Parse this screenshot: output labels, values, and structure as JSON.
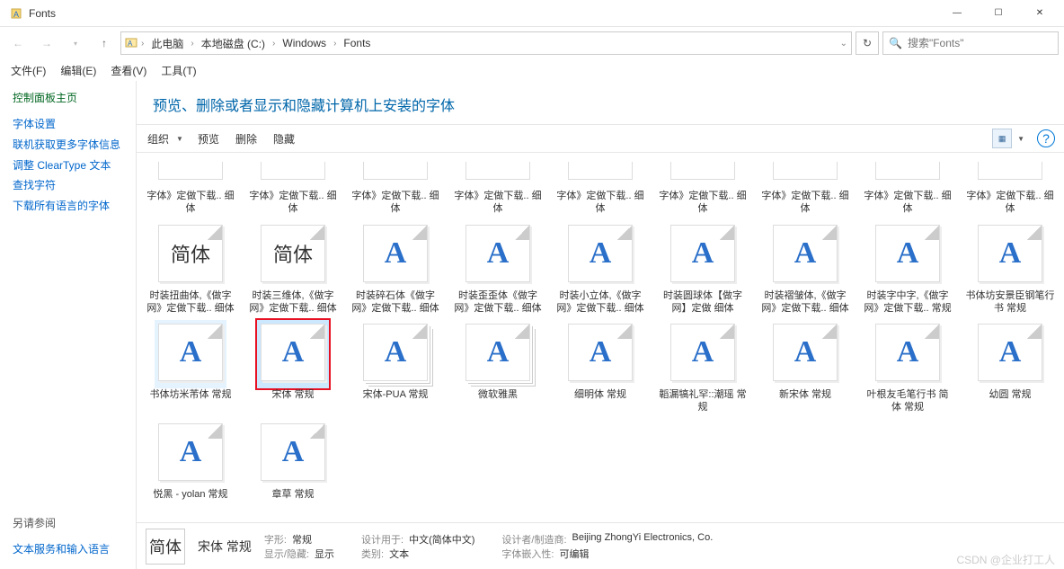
{
  "window": {
    "title": "Fonts"
  },
  "controls": {
    "min": "—",
    "max": "☐",
    "close": "✕"
  },
  "breadcrumbs": [
    "此电脑",
    "本地磁盘 (C:)",
    "Windows",
    "Fonts"
  ],
  "search": {
    "placeholder": "搜索\"Fonts\""
  },
  "menus": [
    "文件(F)",
    "编辑(E)",
    "查看(V)",
    "工具(T)"
  ],
  "sidebar": {
    "head": "控制面板主页",
    "links": [
      "字体设置",
      "联机获取更多字体信息",
      "调整 ClearType 文本",
      "查找字符",
      "下载所有语言的字体"
    ],
    "see_also": "另请参阅",
    "see_links": [
      "文本服务和输入语言"
    ]
  },
  "page_title": "预览、删除或者显示和隐藏计算机上安装的字体",
  "toolbar": {
    "organize": "组织",
    "preview": "预览",
    "delete": "删除",
    "hide": "隐藏"
  },
  "row_cut": [
    "字体》定做下载.. 细体",
    "字体》定做下载.. 细体",
    "字体》定做下载.. 细体",
    "字体》定做下载.. 细体",
    "字体》定做下载.. 细体",
    "字体》定做下载.. 细体",
    "字体》定做下载.. 细体",
    "字体》定做下载.. 细体",
    "字体》定做下载.. 细体"
  ],
  "row1": [
    {
      "label": "时装扭曲体,《做字网》定做下载.. 细体",
      "glyph": "简体",
      "dark": true
    },
    {
      "label": "时装三维体,《做字网》定做下载.. 细体",
      "glyph": "简体",
      "dark": true
    },
    {
      "label": "时装碎石体《做字网》定做下载.. 细体",
      "glyph": "A"
    },
    {
      "label": "时装歪歪体《做字网》定做下载.. 细体",
      "glyph": "A"
    },
    {
      "label": "时装小立体,《做字网》定做下载.. 细体",
      "glyph": "A"
    },
    {
      "label": "时装圆球体【做字网】定做 细体",
      "glyph": "A"
    },
    {
      "label": "时装褶皱体,《做字网》定做下载.. 细体",
      "glyph": "A"
    },
    {
      "label": "时装字中字,《做字网》定做下载.. 常规",
      "glyph": "A"
    },
    {
      "label": "书体坊安景臣钢笔行书 常规",
      "glyph": "A"
    }
  ],
  "row2": [
    {
      "label": "书体坊米芾体 常规",
      "glyph": "A",
      "hover": true
    },
    {
      "label": "宋体 常规",
      "glyph": "A",
      "selected": true
    },
    {
      "label": "宋体-PUA 常规",
      "glyph": "A",
      "stack": true
    },
    {
      "label": "微软雅黑",
      "glyph": "A",
      "stack": true
    },
    {
      "label": "细明体 常规",
      "glyph": "A"
    },
    {
      "label": "韜漏犒礼罕::潮瑶 常规",
      "glyph": "A"
    },
    {
      "label": "新宋体 常规",
      "glyph": "A"
    },
    {
      "label": "叶根友毛笔行书 简体 常规",
      "glyph": "A"
    },
    {
      "label": "幼圆 常规",
      "glyph": "A"
    }
  ],
  "row3": [
    {
      "label": "悦黑 - yolan 常规",
      "glyph": "A"
    },
    {
      "label": "章草 常规",
      "glyph": "A"
    }
  ],
  "detail": {
    "thumb_text": "简体",
    "name": "宋体 常规",
    "props": [
      {
        "k": "字形:",
        "v": "常规"
      },
      {
        "k": "显示/隐藏:",
        "v": "显示"
      },
      {
        "k": "设计用于:",
        "v": "中文(简体中文)"
      },
      {
        "k": "类别:",
        "v": "文本"
      },
      {
        "k": "设计者/制造商:",
        "v": "Beijing ZhongYi Electronics, Co."
      },
      {
        "k": "字体嵌入性:",
        "v": "可编辑"
      }
    ]
  },
  "watermark": "CSDN @企业打工人"
}
